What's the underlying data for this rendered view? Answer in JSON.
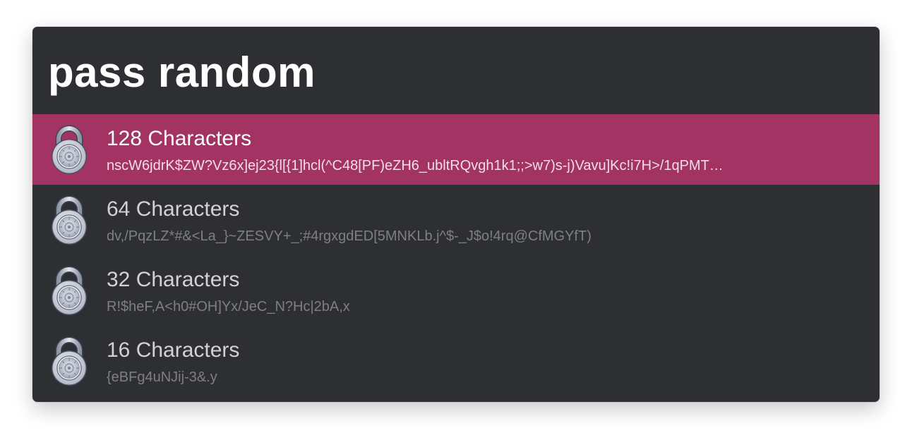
{
  "search": {
    "query": "pass random"
  },
  "results": [
    {
      "title": "128 Characters",
      "subtitle": "nscW6jdrK$ZW?Vz6x]ej23{l[{1]hcl(^C48[PF)eZH6_ubltRQvgh1k1;;>w7)s-j)Vavu]Kc!i7H>/1qPMT…",
      "icon": "padlock-icon",
      "selected": true
    },
    {
      "title": "64 Characters",
      "subtitle": "dv,/PqzLZ*#&<La_}~ZESVY+_;#4rgxgdED[5MNKLb.j^$-_J$o!4rq@CfMGYfT)",
      "icon": "padlock-icon",
      "selected": false
    },
    {
      "title": "32 Characters",
      "subtitle": "R!$heF,A<h0#OH]Yx/JeC_N?Hc|2bA,x",
      "icon": "padlock-icon",
      "selected": false
    },
    {
      "title": "16 Characters",
      "subtitle": "{eBFg4uNJij-3&.y",
      "icon": "padlock-icon",
      "selected": false
    }
  ],
  "colors": {
    "window_background": "#2e2f33",
    "selection_accent": "#a23362",
    "title_text": "#d2d2d6",
    "subtitle_text": "#7e7f86"
  }
}
